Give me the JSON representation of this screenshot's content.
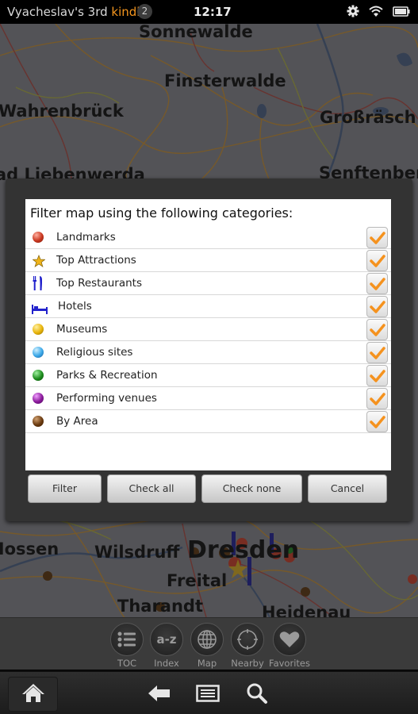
{
  "status_bar": {
    "device_owner": "Vyacheslav's 3rd ",
    "device_brand": "kindle",
    "notification_count": "2",
    "time": "12:17",
    "icons": [
      "gear-icon",
      "wifi-icon",
      "battery-icon"
    ]
  },
  "map": {
    "places": [
      "Sonnewalde",
      "Finsterwalde",
      "Wahrenbrück",
      "Großräsch",
      "Bad Liebenwerda",
      "Senftenberg",
      "Nossen",
      "Wilsdruff",
      "Dresden",
      "Freital",
      "Tharandt",
      "Heidenau"
    ]
  },
  "dialog": {
    "prompt": "Filter map using the following categories:",
    "categories": [
      {
        "label": "Landmarks",
        "icon": "red-ball-icon",
        "color": "#c8361f",
        "checked": true
      },
      {
        "label": "Top Attractions",
        "icon": "star-icon",
        "color": "#f0b419",
        "checked": true
      },
      {
        "label": "Top Restaurants",
        "icon": "fork-knife-icon",
        "color": "#2222cc",
        "checked": true
      },
      {
        "label": "Hotels",
        "icon": "bed-icon",
        "color": "#2222cc",
        "checked": true
      },
      {
        "label": "Museums",
        "icon": "yellow-ball-icon",
        "color": "#e8b40a",
        "checked": true
      },
      {
        "label": "Religious sites",
        "icon": "blue-ball-icon",
        "color": "#3aa8e8",
        "checked": true
      },
      {
        "label": "Parks & Recreation",
        "icon": "green-ball-icon",
        "color": "#1e8c1e",
        "checked": true
      },
      {
        "label": "Performing venues",
        "icon": "purple-ball-icon",
        "color": "#8a1a9a",
        "checked": true
      },
      {
        "label": "By Area",
        "icon": "brown-ball-icon",
        "color": "#6a3a10",
        "checked": true
      }
    ],
    "buttons": {
      "filter": "Filter",
      "check_all": "Check all",
      "check_none": "Check none",
      "cancel": "Cancel"
    },
    "check_color": "#f5921e"
  },
  "toolbar": {
    "items": [
      {
        "label": "TOC",
        "icon": "list-icon"
      },
      {
        "label": "Index",
        "icon": "a-z-icon",
        "glyph": "a-z"
      },
      {
        "label": "Map",
        "icon": "globe-icon"
      },
      {
        "label": "Nearby",
        "icon": "crosshair-icon"
      },
      {
        "label": "Favorites",
        "icon": "heart-icon"
      }
    ]
  },
  "navbar": {
    "icons": [
      "home-icon",
      "back-icon",
      "menu-icon",
      "search-icon"
    ]
  }
}
